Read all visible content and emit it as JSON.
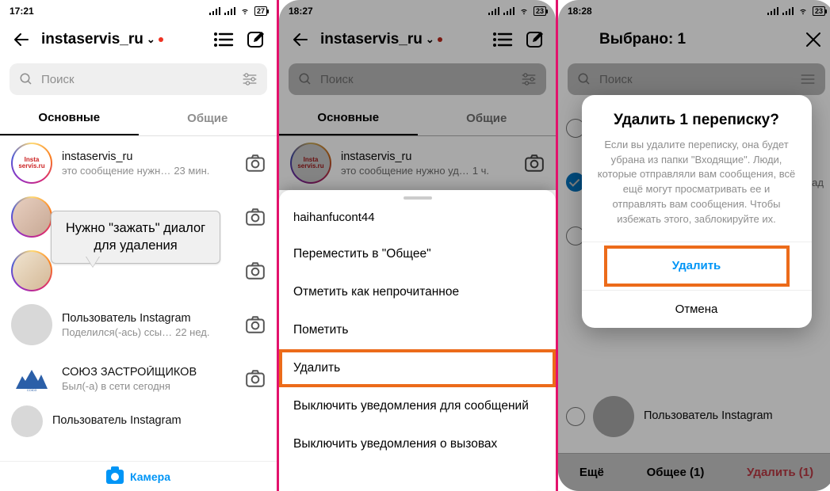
{
  "panel1": {
    "status_time": "17:21",
    "batt": "27",
    "account": "instaservis_ru",
    "search_placeholder": "Поиск",
    "tabs": {
      "primary": "Основные",
      "general": "Общие"
    },
    "chats": [
      {
        "name": "instaservis_ru",
        "sub": "это сообщение нужн…",
        "time": "23 мин."
      },
      {
        "name": "",
        "sub": "",
        "time": ""
      },
      {
        "name": "",
        "sub": "",
        "time": ""
      },
      {
        "name": "Пользователь Instagram",
        "sub": "Поделился(-ась) ссы…",
        "time": "22 нед."
      },
      {
        "name": "СОЮЗ ЗАСТРОЙЩИКОВ",
        "sub": "Был(-а) в сети сегодня",
        "time": ""
      },
      {
        "name": "Пользователь Instagram",
        "sub": "",
        "time": ""
      }
    ],
    "callout": "Нужно \"зажать\" диалог для удаления",
    "camera_label": "Камера"
  },
  "panel2": {
    "status_time": "18:27",
    "batt": "23",
    "account": "instaservis_ru",
    "search_placeholder": "Поиск",
    "tabs": {
      "primary": "Основные",
      "general": "Общие"
    },
    "top_chat": {
      "name": "instaservis_ru",
      "sub": "это сообщение нужно уд…",
      "time": "1 ч."
    },
    "sheet_user": "haihanfucont44",
    "sheet_options": [
      "Переместить в \"Общее\"",
      "Отметить как непрочитанное",
      "Пометить",
      "Удалить",
      "Выключить уведомления для сообщений",
      "Выключить уведомления о вызовах"
    ],
    "highlight_index": 3
  },
  "panel3": {
    "status_time": "18:28",
    "batt": "23",
    "title": "Выбрано: 1",
    "search_placeholder": "Поиск",
    "dialog": {
      "title": "Удалить 1 переписку?",
      "body": "Если вы удалите переписку, она будет убрана из папки \"Входящие\". Люди, которые отправляли вам сообщения, всё ещё могут просматривать ее и отправлять вам сообщения. Чтобы избежать этого, заблокируйте их.",
      "delete": "Удалить",
      "cancel": "Отмена"
    },
    "bg_chats": [
      {
        "name": "",
        "sub": ""
      },
      {
        "name": "",
        "sub": "ад"
      },
      {
        "name": "",
        "sub": ""
      },
      {
        "name": "Пользователь Instagram",
        "sub": ""
      }
    ],
    "bottombar": {
      "more": "Ещё",
      "general": "Общее (1)",
      "delete": "Удалить (1)"
    }
  }
}
